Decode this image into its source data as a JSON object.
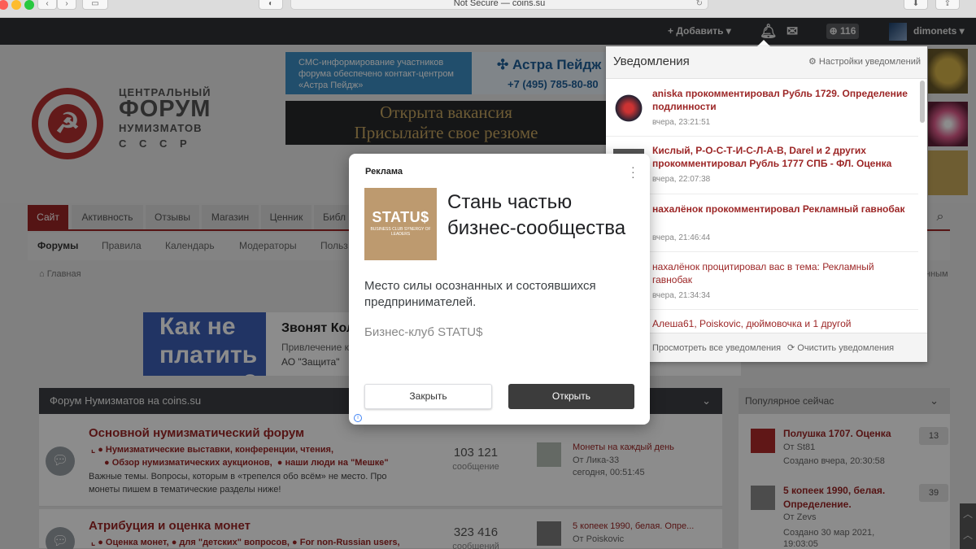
{
  "browser": {
    "address": "Not Secure — coins.su"
  },
  "topbar": {
    "add_label": "Добавить",
    "badge_count": "116",
    "username": "dimonets"
  },
  "header": {
    "logo_lines": [
      "ЦЕНТРАЛЬНЫЙ",
      "ФОРУМ",
      "НУМИЗМАТОВ",
      "С С С Р"
    ],
    "banner1_text": "СМС-информирование участников форума обеспечено контакт-центром «Астра Пейдж»",
    "banner1_brand": "Астра Пейдж",
    "banner1_phone": "+7 (495) 785-80-80",
    "banner2_line1": "Открыта вакансия",
    "banner2_line2": "Присылайте свое резюме"
  },
  "nav": {
    "tabs": [
      "Сайт",
      "Активность",
      "Отзывы",
      "Магазин",
      "Ценник",
      "Библ"
    ],
    "subtabs": [
      "Форумы",
      "Правила",
      "Календарь",
      "Модераторы",
      "Польз"
    ]
  },
  "breadcrumb": "Главная",
  "breadcrumb_right": "нным",
  "ad2": {
    "image_text": "Как не платить кредит?",
    "title": "Звонят Кол",
    "subtitle": "Привлечение к",
    "advertiser": "АО \"Защита\""
  },
  "forum": {
    "section_title": "Форум Нумизматов на coins.su",
    "rows": [
      {
        "title": "Основной нумизматический форум",
        "sub1": "Нумизматические выставки, конференции, чтения,",
        "sub2a": "Обзор нумизматических аукционов,",
        "sub2b": "наши люди на \"Мешке\"",
        "desc": "Важные темы. Вопросы, которым в «трепелся обо всём» не место. Про монеты пишем в тематические разделы ниже!",
        "count": "103 121",
        "count_label": "сообщение",
        "last_title": "Монеты на каждый день",
        "last_by": "От Лика-33",
        "last_date": "сегодня, 00:51:45"
      },
      {
        "title": "Атрибуция и оценка монет",
        "sub1a": "Оценка монет,",
        "sub1b": "для \"детских\" вопросов,",
        "sub1c": "For non-Russian users,",
        "count": "323 416",
        "count_label": "сообщений",
        "last_title": "5 копеек 1990, белая. Опре...",
        "last_by": "От Poiskovic"
      }
    ]
  },
  "sidebar": {
    "title": "Популярное сейчас",
    "items": [
      {
        "title": "Полушка 1707. Оценка",
        "by": "От St81",
        "date": "Создано вчера, 20:30:58",
        "count": "13"
      },
      {
        "title": "5 копеек 1990, белая. Определение.",
        "by": "От Zevs",
        "date": "Создано 30 мар 2021, 19:03:05",
        "count": "39"
      }
    ]
  },
  "notifications": {
    "title": "Уведомления",
    "settings_label": "Настройки уведомлений",
    "items": [
      {
        "text": "aniska прокомментировал Рубль 1729. Определение подлинности",
        "date": "вчера, 23:21:51",
        "bold": true
      },
      {
        "text": "Кислый, Р-О-С-Т-И-С-Л-А-В, Darel и 2 других прокомментировал Рубль 1777 СПБ - ФЛ. Оценка",
        "date": "вчера, 22:07:38",
        "bold": true
      },
      {
        "text": "нахалёнок прокомментировал Рекламный гавнобак",
        "date": "вчера, 21:46:44",
        "bold": true
      },
      {
        "text": "нахалёнок процитировал вас в тема: Рекламный гавнобак",
        "date": "вчера, 21:34:34",
        "bold": false
      },
      {
        "text": "Алеша61, Poiskovic, дюймовочка и 1 другой",
        "date": "",
        "bold": false
      }
    ],
    "view_all": "Просмотреть все уведомления",
    "clear_all": "Очистить уведомления"
  },
  "ad_modal": {
    "label": "Реклама",
    "logo_text": "STATU$",
    "logo_small": "BUSINESS CLUB SYNERGY OF LEADERS",
    "headline": "Стань частью бизнес-сообщества",
    "body": "Место силы осознанных и состоявшихся предпринимателей.",
    "advertiser": "Бизнес-клуб STATU$",
    "close_label": "Закрыть",
    "open_label": "Открыть"
  },
  "colors": {
    "accent": "#9c2626",
    "topbar": "#303236",
    "modal_logo": "#bd9a6f"
  }
}
